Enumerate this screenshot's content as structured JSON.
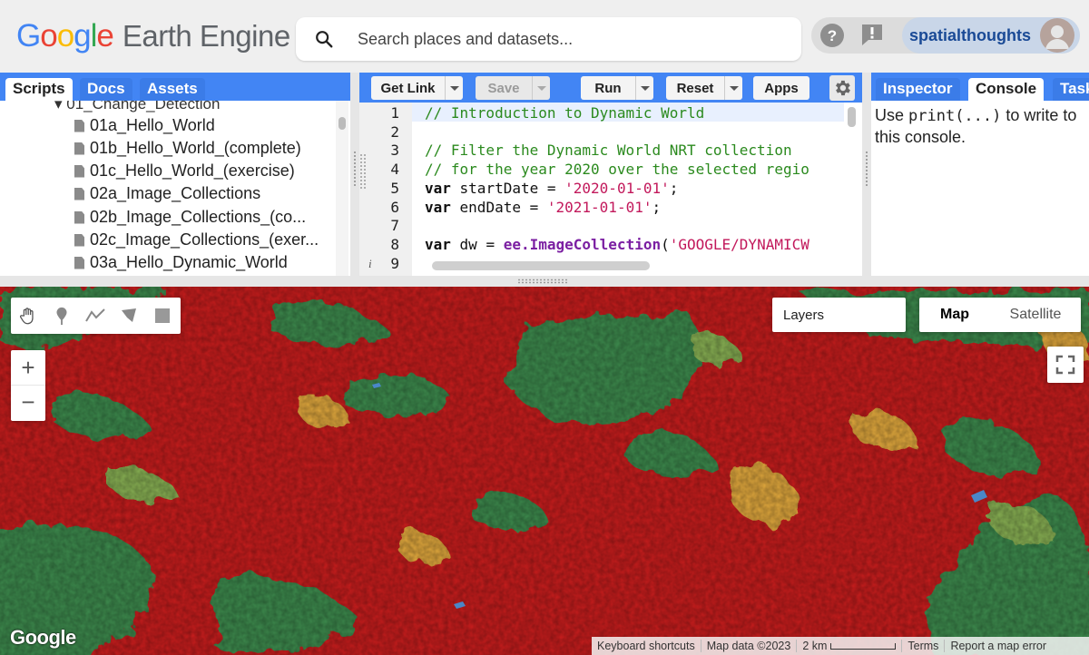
{
  "header": {
    "logo_word": "Google",
    "product_name": "Earth Engine",
    "search_placeholder": "Search places and datasets...",
    "username": "spatialthoughts",
    "icons": [
      "search-icon",
      "help-icon",
      "feedback-icon",
      "avatar"
    ]
  },
  "left_panel": {
    "tabs": [
      {
        "label": "Scripts",
        "active": true
      },
      {
        "label": "Docs",
        "active": false
      },
      {
        "label": "Assets",
        "active": false
      }
    ],
    "folder": "01_Change_Detection",
    "scripts": [
      "01a_Hello_World",
      "01b_Hello_World_(complete)",
      "01c_Hello_World_(exercise)",
      "02a_Image_Collections",
      "02b_Image_Collections_(co...",
      "02c_Image_Collections_(exer...",
      "03a_Hello_Dynamic_World"
    ]
  },
  "editor": {
    "toolbar": {
      "get_link": "Get Link",
      "save": "Save",
      "run": "Run",
      "reset": "Reset",
      "apps": "Apps"
    },
    "line_numbers": [
      "1",
      "2",
      "3",
      "4",
      "5",
      "6",
      "7",
      "8",
      "9"
    ],
    "code": {
      "l1": "// Introduction to Dynamic World",
      "l3": "// Filter the Dynamic World NRT collection",
      "l4": "// for the year 2020 over the selected regio",
      "l5_kw": "var",
      "l5_name": " startDate = ",
      "l5_str": "'2020-01-01'",
      "l5_end": ";",
      "l6_kw": "var",
      "l6_name": " endDate = ",
      "l6_str": "'2021-01-01'",
      "l6_end": ";",
      "l8_kw": "var",
      "l8_name": " dw = ",
      "l8_ee": "ee.ImageCollection",
      "l8_paren": "(",
      "l8_str": "'GOOGLE/DYNAMICW"
    }
  },
  "right_panel": {
    "tabs": [
      {
        "label": "Inspector",
        "active": false
      },
      {
        "label": "Console",
        "active": true
      },
      {
        "label": "Tasks",
        "active": false
      }
    ],
    "console_pre": "Use ",
    "console_code": "print(...)",
    "console_post": " to write to this console."
  },
  "map": {
    "layers_label": "Layers",
    "map_types": [
      {
        "label": "Map",
        "selected": true
      },
      {
        "label": "Satellite",
        "selected": false
      }
    ],
    "zoom_in": "+",
    "zoom_out": "−",
    "google_logo": "Google",
    "attribution": {
      "keyboard": "Keyboard shortcuts",
      "map_data": "Map data ©2023",
      "scale": "2 km",
      "terms": "Terms",
      "report": "Report a map error"
    },
    "colors": {
      "built": "#c81d1d",
      "trees": "#3d8a4e",
      "crops": "#e1a83c",
      "grass": "#88b053",
      "water": "#4a87c8"
    }
  },
  "theme": {
    "accent": "#4285f4"
  }
}
